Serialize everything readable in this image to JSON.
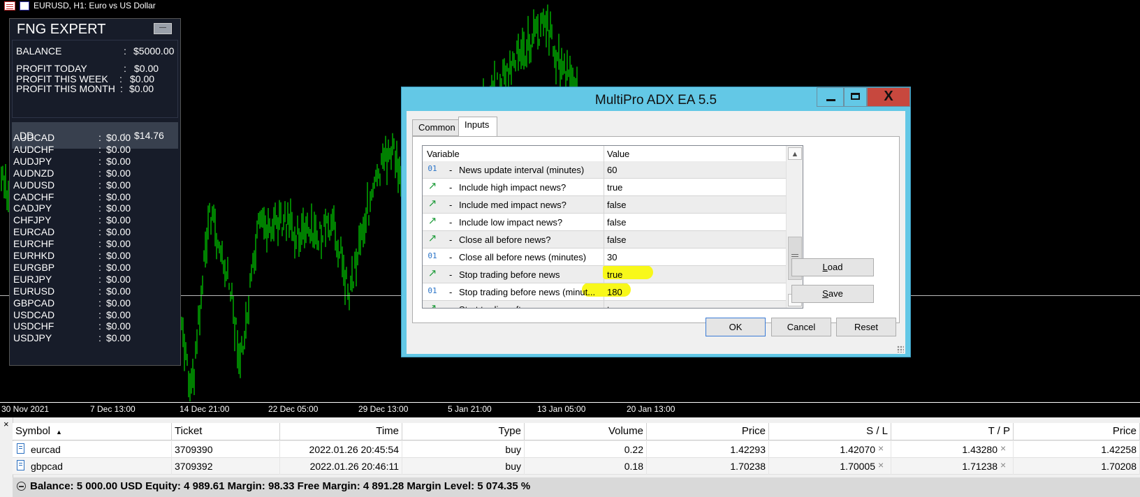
{
  "chart": {
    "title": "EURUSD, H1:  Euro vs US Dollar",
    "dates": [
      "30 Nov 2021",
      "7 Dec 13:00",
      "14 Dec 21:00",
      "22 Dec 05:00",
      "29 Dec 13:00",
      "5 Jan 21:00",
      "13 Jan 05:00",
      "20 Jan 13:00"
    ],
    "colors": {
      "background": "#000000",
      "candles": "#00ff00",
      "axis_text": "#ffffff"
    }
  },
  "fng": {
    "title": "FNG EXPERT",
    "minimize_label": "—",
    "balance_label": "BALANCE",
    "balance_value": "$5000.00",
    "profit_today_label": "PROFIT TODAY",
    "profit_today_value": "$0.00",
    "profit_week_label": "PROFIT THIS WEEK",
    "profit_week_value": "$0.00",
    "profit_month_label": "PROFIT THIS MONTH",
    "profit_month_value": "$0.00",
    "dd_label": "DD",
    "dd_value": "$14.76",
    "colon": ":",
    "symbols": [
      {
        "name": "AUDCAD",
        "value": "$0.00"
      },
      {
        "name": "AUDCHF",
        "value": "$0.00"
      },
      {
        "name": "AUDJPY",
        "value": "$0.00"
      },
      {
        "name": "AUDNZD",
        "value": "$0.00"
      },
      {
        "name": "AUDUSD",
        "value": "$0.00"
      },
      {
        "name": "CADCHF",
        "value": "$0.00"
      },
      {
        "name": "CADJPY",
        "value": "$0.00"
      },
      {
        "name": "CHFJPY",
        "value": "$0.00"
      },
      {
        "name": "EURCAD",
        "value": "$0.00"
      },
      {
        "name": "EURCHF",
        "value": "$0.00"
      },
      {
        "name": "EURHKD",
        "value": "$0.00"
      },
      {
        "name": "EURGBP",
        "value": "$0.00"
      },
      {
        "name": "EURJPY",
        "value": "$0.00"
      },
      {
        "name": "EURUSD",
        "value": "$0.00"
      },
      {
        "name": "GBPCAD",
        "value": "$0.00"
      },
      {
        "name": "USDCAD",
        "value": "$0.00"
      },
      {
        "name": "USDCHF",
        "value": "$0.00"
      },
      {
        "name": "USDJPY",
        "value": "$0.00"
      }
    ]
  },
  "dialog": {
    "title": "MultiPro ADX EA 5.5",
    "close_glyph": "X",
    "tabs": [
      {
        "label": "Common"
      },
      {
        "label": "Inputs"
      }
    ],
    "grid_headers": {
      "variable": "Variable",
      "value": "Value"
    },
    "params": [
      {
        "type": "num",
        "icon": "01",
        "dash": "-",
        "variable": "News update interval (minutes)",
        "value": "60"
      },
      {
        "type": "bool",
        "icon": "↗",
        "dash": "-",
        "variable": "Include high impact news?",
        "value": "true"
      },
      {
        "type": "bool",
        "icon": "↗",
        "dash": "-",
        "variable": "Include med impact news?",
        "value": "false"
      },
      {
        "type": "bool",
        "icon": "↗",
        "dash": "-",
        "variable": "Include low impact news?",
        "value": "false"
      },
      {
        "type": "bool",
        "icon": "↗",
        "dash": "-",
        "variable": "Close all before news?",
        "value": "false"
      },
      {
        "type": "num",
        "icon": "01",
        "dash": "-",
        "variable": "Close all before news (minutes)",
        "value": "30"
      },
      {
        "type": "bool",
        "icon": "↗",
        "dash": "-",
        "variable": "Stop trading before news",
        "value": "true"
      },
      {
        "type": "num",
        "icon": "01",
        "dash": "-",
        "variable": "Stop trading before news (minut...",
        "value": "180"
      },
      {
        "type": "bool",
        "icon": "↗",
        "dash": "-",
        "variable": "Start trading after news",
        "value": "true"
      }
    ],
    "highlight_color": "#f8f81a",
    "scroll_up": "▲",
    "scroll_down": "▼",
    "load_label_u": "L",
    "load_label_rest": "oad",
    "save_label_u": "S",
    "save_label_rest": "ave",
    "ok_label": "OK",
    "cancel_label": "Cancel",
    "reset_label": "Reset"
  },
  "terminal": {
    "close_glyph": "×",
    "headers": {
      "symbol": "Symbol",
      "sort_glyph": "▲",
      "ticket": "Ticket",
      "time": "Time",
      "type": "Type",
      "volume": "Volume",
      "price": "Price",
      "sl": "S / L",
      "tp": "T / P",
      "price2": "Price"
    },
    "rows": [
      {
        "symbol": "eurcad",
        "ticket": "3709390",
        "time": "2022.01.26 20:45:54",
        "type": "buy",
        "volume": "0.22",
        "price": "1.42293",
        "sl": "1.42070",
        "tp": "1.43280",
        "price2": "1.42258"
      },
      {
        "symbol": "gbpcad",
        "ticket": "3709392",
        "time": "2022.01.26 20:46:11",
        "type": "buy",
        "volume": "0.18",
        "price": "1.70238",
        "sl": "1.70005",
        "tp": "1.71238",
        "price2": "1.70208"
      }
    ],
    "remove_glyph": "×",
    "summary": "Balance: 5 000.00 USD  Equity: 4 989.61  Margin: 98.33  Free Margin: 4 891.28  Margin Level: 5 074.35 %"
  }
}
